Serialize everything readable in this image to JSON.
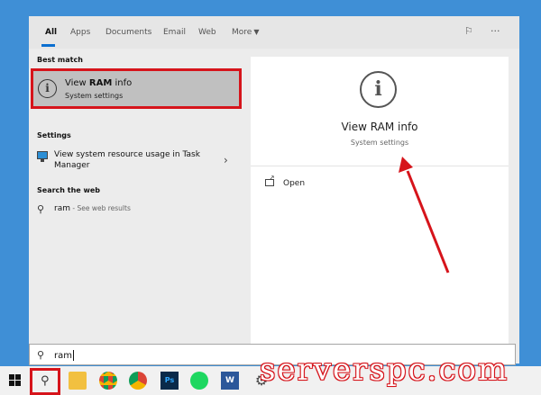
{
  "tabs": [
    {
      "label": "All",
      "active": true
    },
    {
      "label": "Apps"
    },
    {
      "label": "Documents"
    },
    {
      "label": "Email"
    },
    {
      "label": "Web"
    },
    {
      "label": "More"
    }
  ],
  "toolbar_icons": [
    "feedback-icon",
    "more-options-icon"
  ],
  "sections": {
    "best_match": "Best match",
    "settings": "Settings",
    "search_web": "Search the web"
  },
  "best_match_item": {
    "title_prefix": "View ",
    "title_bold": "RAM",
    "title_suffix": " info",
    "subtitle": "System settings"
  },
  "settings_item": {
    "label": "View system resource usage in Task Manager"
  },
  "web_item": {
    "query": "ram",
    "suffix": " - See web results"
  },
  "preview": {
    "title": "View RAM info",
    "subtitle": "System settings",
    "action_open": "Open"
  },
  "search": {
    "value": "ram"
  },
  "taskbar_apps": [
    "windows-start",
    "search",
    "file-explorer",
    "chrome",
    "chrome",
    "photoshop",
    "spotify",
    "word",
    "settings"
  ],
  "watermark": "serverspc.com",
  "colors": {
    "highlight_red": "#d6141b",
    "accent_blue": "#0b6fd0",
    "desktop_blue": "#3f8fd6"
  }
}
